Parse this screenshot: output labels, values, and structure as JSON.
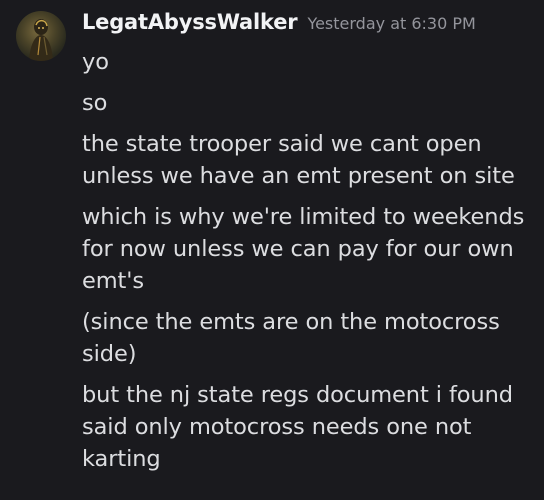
{
  "message": {
    "author": "LegatAbyssWalker",
    "timestamp": "Yesterday at 6:30 PM",
    "avatar_icon": "user-avatar-icon",
    "lines": [
      "yo",
      "so",
      "the state trooper said we cant open unless we have an emt present on site",
      "which is why we're limited to weekends for now unless we can pay for our own emt's",
      "(since the emts are on the motocross side)",
      "but the nj state regs document i found said only motocross needs one not karting"
    ]
  },
  "colors": {
    "background": "#1a1a1e",
    "username": "#f2f3f5",
    "timestamp": "#94959c",
    "text": "#dcdde0"
  }
}
